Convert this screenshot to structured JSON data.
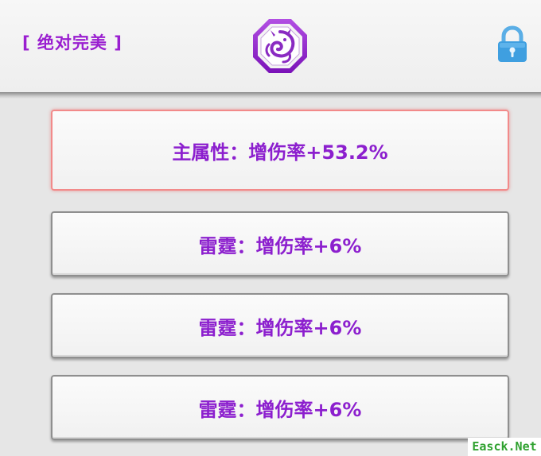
{
  "header": {
    "quality_label": "[ 绝对完美 ]",
    "emblem_icon": "dragon-emblem-icon",
    "lock_icon": "lock-icon"
  },
  "attributes": {
    "primary": "主属性：增伤率+53.2%",
    "secondary": [
      "雷霆：增伤率+6%",
      "雷霆：增伤率+6%",
      "雷霆：增伤率+6%"
    ]
  },
  "watermark": "Easck.Net",
  "colors": {
    "accent_purple": "#8c1fce",
    "primary_border": "#f28a8a",
    "lock_blue": "#3f9fe0",
    "watermark_green": "#2fa12f"
  }
}
